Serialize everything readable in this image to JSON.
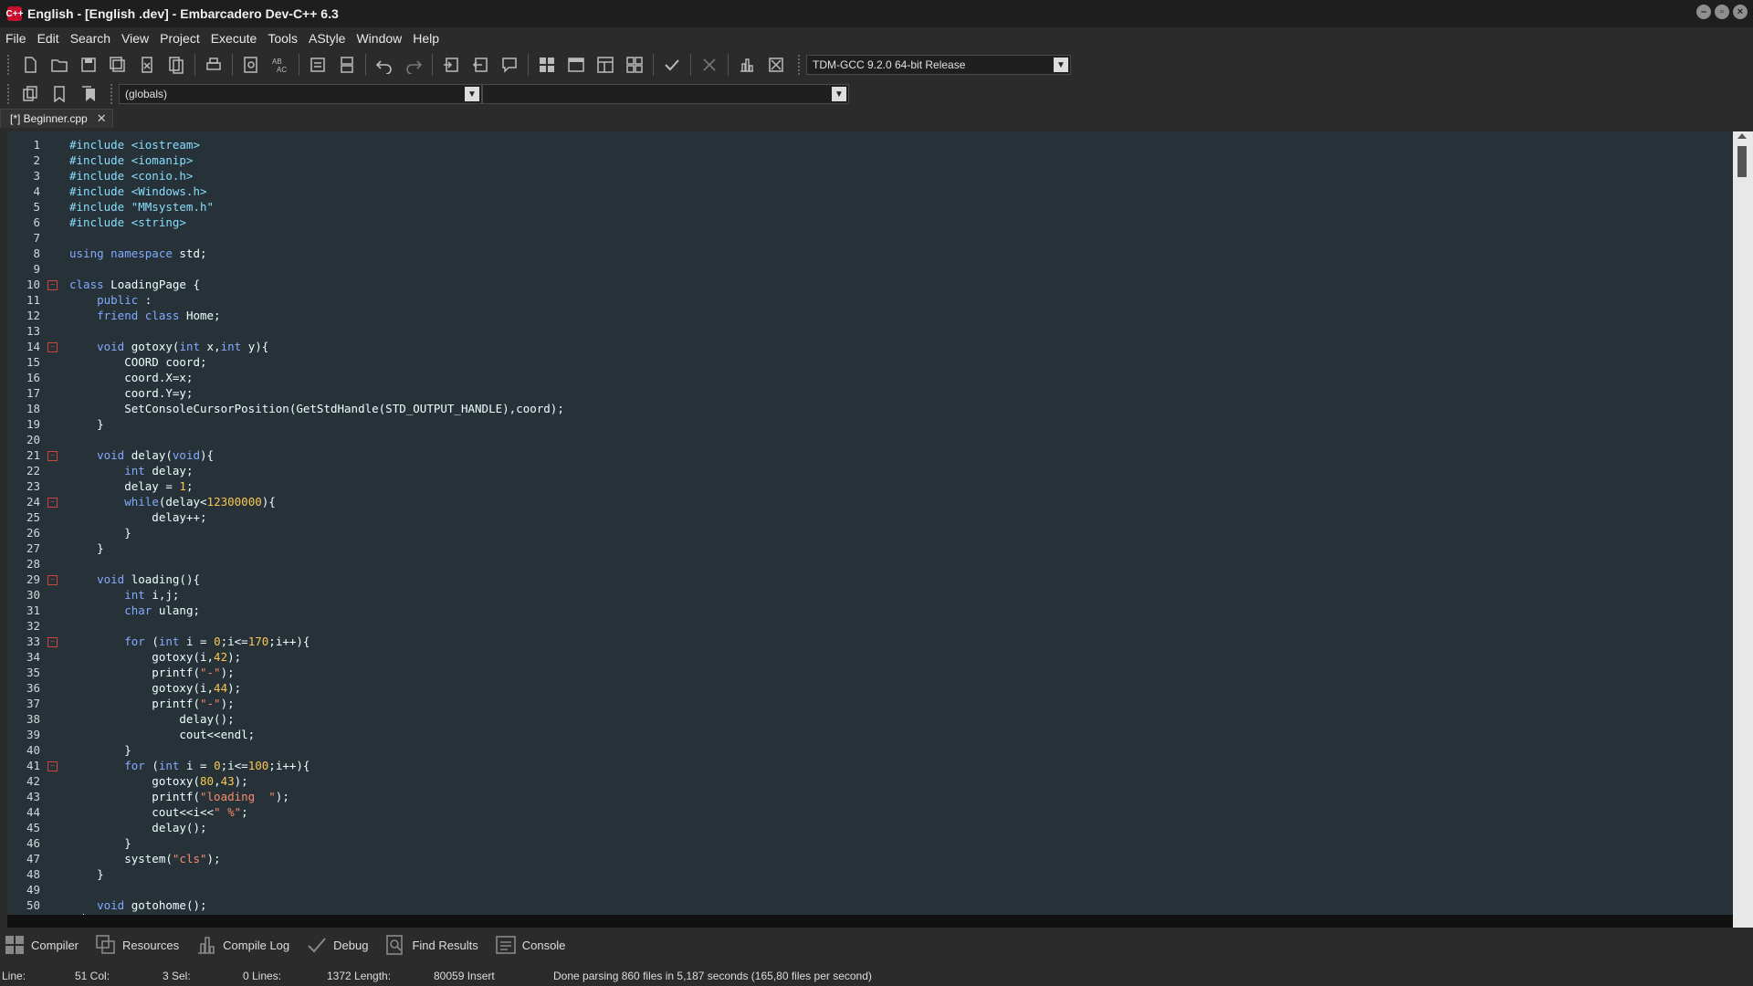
{
  "window": {
    "title": "English - [English .dev] - Embarcadero Dev-C++ 6.3",
    "app_icon_text": "C++",
    "controls": [
      "minimize",
      "restore",
      "close"
    ]
  },
  "menu": [
    "File",
    "Edit",
    "Search",
    "View",
    "Project",
    "Execute",
    "Tools",
    "AStyle",
    "Window",
    "Help"
  ],
  "toolbar": {
    "compiler_select": "TDM-GCC 9.2.0 64-bit Release",
    "scope_select": "(globals)",
    "members_select": ""
  },
  "tabs": [
    {
      "label": "[*] Beginner.cpp",
      "active": true
    }
  ],
  "editor": {
    "fold_lines": [
      10,
      14,
      21,
      24,
      29,
      33,
      41
    ],
    "cursor": {
      "line": 51,
      "col": 3
    },
    "lines": [
      [
        [
          "pp",
          "#include <iostream>"
        ]
      ],
      [
        [
          "pp",
          "#include <iomanip>"
        ]
      ],
      [
        [
          "pp",
          "#include <conio.h>"
        ]
      ],
      [
        [
          "pp",
          "#include <Windows.h>"
        ]
      ],
      [
        [
          "pp",
          "#include \"MMsystem.h\""
        ]
      ],
      [
        [
          "pp",
          "#include <string>"
        ]
      ],
      [],
      [
        [
          "kw",
          "using namespace"
        ],
        [
          "plain",
          " std;"
        ]
      ],
      [],
      [
        [
          "kw",
          "class"
        ],
        [
          "plain",
          " LoadingPage {"
        ]
      ],
      [
        [
          "plain",
          "    "
        ],
        [
          "kw",
          "public"
        ],
        [
          "plain",
          " :"
        ]
      ],
      [
        [
          "plain",
          "    "
        ],
        [
          "kw",
          "friend class"
        ],
        [
          "plain",
          " Home;"
        ]
      ],
      [],
      [
        [
          "plain",
          "    "
        ],
        [
          "kw",
          "void"
        ],
        [
          "plain",
          " gotoxy("
        ],
        [
          "kw",
          "int"
        ],
        [
          "plain",
          " x,"
        ],
        [
          "kw",
          "int"
        ],
        [
          "plain",
          " y){"
        ]
      ],
      [
        [
          "plain",
          "        COORD coord;"
        ]
      ],
      [
        [
          "plain",
          "        coord.X=x;"
        ]
      ],
      [
        [
          "plain",
          "        coord.Y=y;"
        ]
      ],
      [
        [
          "plain",
          "        SetConsoleCursorPosition(GetStdHandle(STD_OUTPUT_HANDLE),coord);"
        ]
      ],
      [
        [
          "plain",
          "    }"
        ]
      ],
      [],
      [
        [
          "plain",
          "    "
        ],
        [
          "kw",
          "void"
        ],
        [
          "plain",
          " delay("
        ],
        [
          "kw",
          "void"
        ],
        [
          "plain",
          "){"
        ]
      ],
      [
        [
          "plain",
          "        "
        ],
        [
          "kw",
          "int"
        ],
        [
          "plain",
          " delay;"
        ]
      ],
      [
        [
          "plain",
          "        delay = "
        ],
        [
          "num",
          "1"
        ],
        [
          "plain",
          ";"
        ]
      ],
      [
        [
          "plain",
          "        "
        ],
        [
          "kw",
          "while"
        ],
        [
          "plain",
          "(delay<"
        ],
        [
          "num",
          "12300000"
        ],
        [
          "plain",
          "){"
        ]
      ],
      [
        [
          "plain",
          "            delay++;"
        ]
      ],
      [
        [
          "plain",
          "        }"
        ]
      ],
      [
        [
          "plain",
          "    }"
        ]
      ],
      [],
      [
        [
          "plain",
          "    "
        ],
        [
          "kw",
          "void"
        ],
        [
          "plain",
          " loading(){"
        ]
      ],
      [
        [
          "plain",
          "        "
        ],
        [
          "kw",
          "int"
        ],
        [
          "plain",
          " i,j;"
        ]
      ],
      [
        [
          "plain",
          "        "
        ],
        [
          "kw",
          "char"
        ],
        [
          "plain",
          " ulang;"
        ]
      ],
      [],
      [
        [
          "plain",
          "        "
        ],
        [
          "kw",
          "for"
        ],
        [
          "plain",
          " ("
        ],
        [
          "kw",
          "int"
        ],
        [
          "plain",
          " i = "
        ],
        [
          "num",
          "0"
        ],
        [
          "plain",
          ";i<="
        ],
        [
          "num",
          "170"
        ],
        [
          "plain",
          ";i++){"
        ]
      ],
      [
        [
          "plain",
          "            gotoxy(i,"
        ],
        [
          "num",
          "42"
        ],
        [
          "plain",
          ");"
        ]
      ],
      [
        [
          "plain",
          "            printf("
        ],
        [
          "str",
          "\"-\""
        ],
        [
          "plain",
          ");"
        ]
      ],
      [
        [
          "plain",
          "            gotoxy(i,"
        ],
        [
          "num",
          "44"
        ],
        [
          "plain",
          ");"
        ]
      ],
      [
        [
          "plain",
          "            printf("
        ],
        [
          "str",
          "\"-\""
        ],
        [
          "plain",
          ");"
        ]
      ],
      [
        [
          "plain",
          "                delay();"
        ]
      ],
      [
        [
          "plain",
          "                cout<<endl;"
        ]
      ],
      [
        [
          "plain",
          "        }"
        ]
      ],
      [
        [
          "plain",
          "        "
        ],
        [
          "kw",
          "for"
        ],
        [
          "plain",
          " ("
        ],
        [
          "kw",
          "int"
        ],
        [
          "plain",
          " i = "
        ],
        [
          "num",
          "0"
        ],
        [
          "plain",
          ";i<="
        ],
        [
          "num",
          "100"
        ],
        [
          "plain",
          ";i++){"
        ]
      ],
      [
        [
          "plain",
          "            gotoxy("
        ],
        [
          "num",
          "80"
        ],
        [
          "plain",
          ","
        ],
        [
          "num",
          "43"
        ],
        [
          "plain",
          ");"
        ]
      ],
      [
        [
          "plain",
          "            printf("
        ],
        [
          "str",
          "\"loading  \""
        ],
        [
          "plain",
          ");"
        ]
      ],
      [
        [
          "plain",
          "            cout<<i<<"
        ],
        [
          "str",
          "\" %\""
        ],
        [
          "plain",
          ";"
        ]
      ],
      [
        [
          "plain",
          "            delay();"
        ]
      ],
      [
        [
          "plain",
          "        }"
        ]
      ],
      [
        [
          "plain",
          "        system("
        ],
        [
          "str",
          "\"cls\""
        ],
        [
          "plain",
          ");"
        ]
      ],
      [
        [
          "plain",
          "    }"
        ]
      ],
      [],
      [
        [
          "plain",
          "    "
        ],
        [
          "kw",
          "void"
        ],
        [
          "plain",
          " gotohome();"
        ]
      ],
      [
        [
          "plain",
          "};"
        ]
      ]
    ]
  },
  "bottom_tabs": [
    {
      "label": "Compiler",
      "icon": "grid-icon"
    },
    {
      "label": "Resources",
      "icon": "copy-icon"
    },
    {
      "label": "Compile Log",
      "icon": "bar-chart-icon"
    },
    {
      "label": "Debug",
      "icon": "check-icon"
    },
    {
      "label": "Find Results",
      "icon": "search-doc-icon"
    },
    {
      "label": "Console",
      "icon": "console-icon"
    }
  ],
  "status": {
    "line": "Line:",
    "col": "51 Col:",
    "sel": "3 Sel:",
    "lines": "0 Lines:",
    "length": "1372 Length:",
    "insert": "80059 Insert",
    "message": "Done parsing 860 files in 5,187 seconds (165,80 files per second)"
  },
  "colors": {
    "editor_bg": "#263238",
    "keyword": "#82aaff",
    "preprocessor": "#89ddff",
    "string": "#f78c6c",
    "number": "#f9c74f",
    "fold_marker": "#cc4444"
  }
}
